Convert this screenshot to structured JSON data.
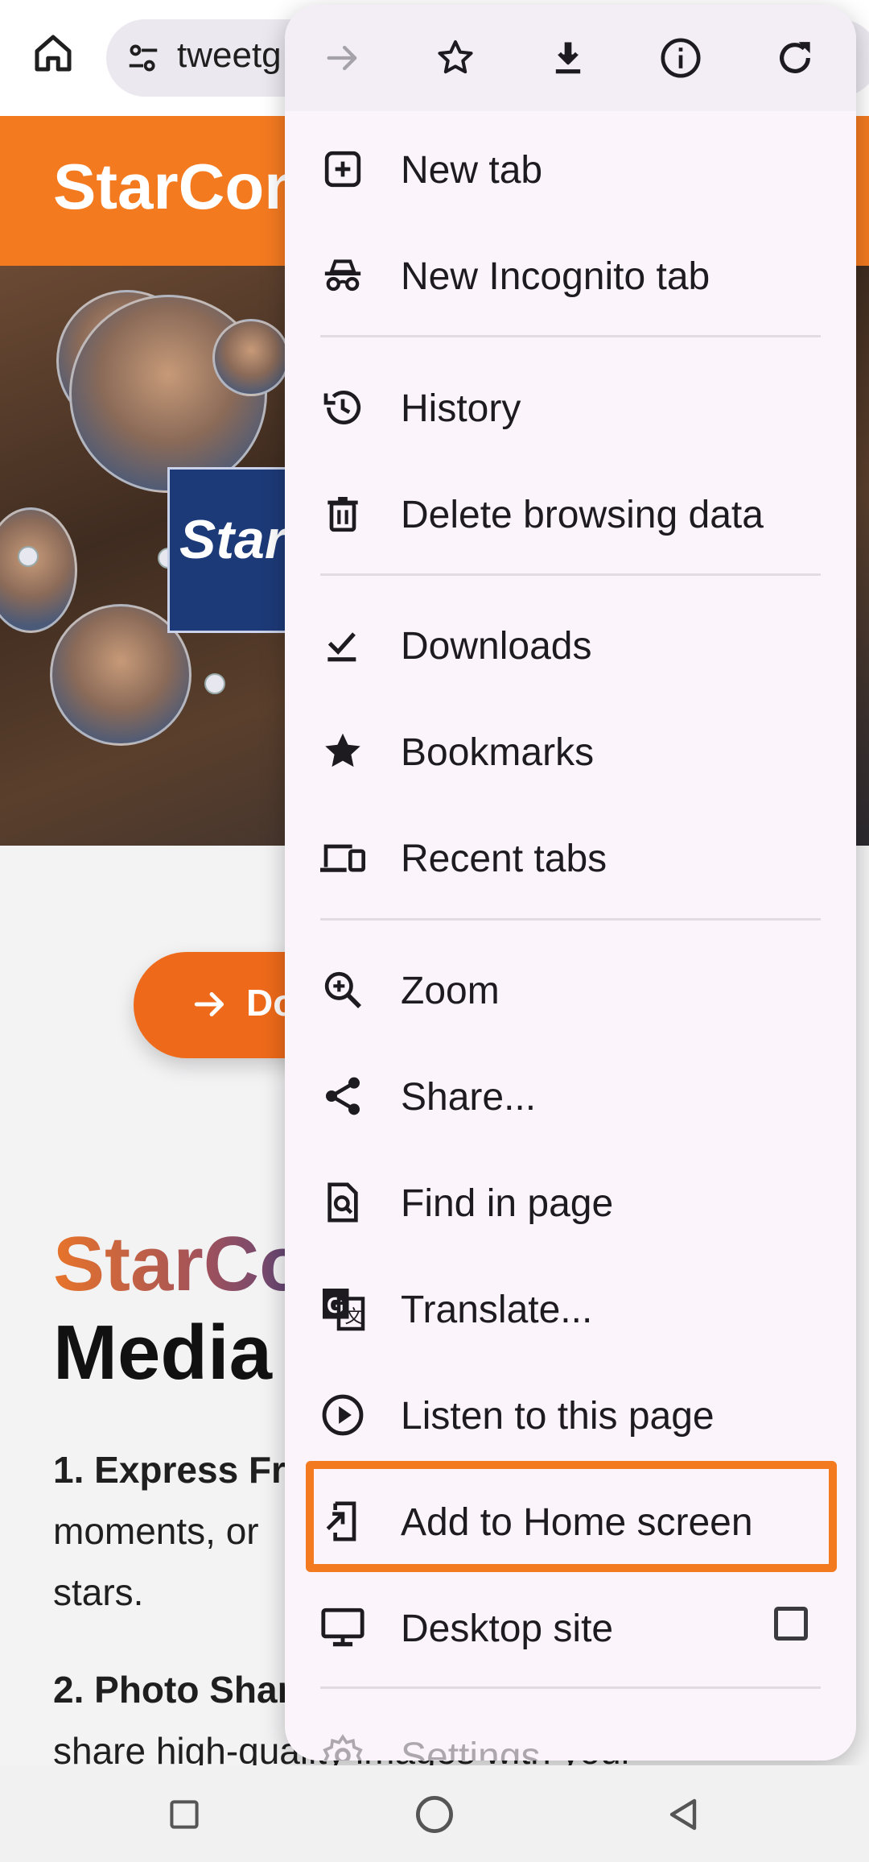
{
  "toolbar": {
    "url_text": "tweetg",
    "home_icon": "home-icon",
    "site_settings_icon": "tune-icon"
  },
  "page": {
    "brand_title": "StarCon",
    "hero_sign_text": "Star",
    "cta_label": "Do",
    "headline_line1": "StarCo",
    "headline_line2": "Media A",
    "section1_title": "1. Express Fr",
    "section1_line1": "moments, or",
    "section1_line2": "stars.",
    "section2_title": "2. Photo Shar",
    "section2_line1": "share high-quality images with your"
  },
  "menu": {
    "top_actions": [
      {
        "name": "forward-icon"
      },
      {
        "name": "star-outline-icon"
      },
      {
        "name": "download-icon"
      },
      {
        "name": "info-icon"
      },
      {
        "name": "refresh-icon"
      }
    ],
    "items": [
      {
        "label": "New tab",
        "icon": "new-tab-icon"
      },
      {
        "label": "New Incognito tab",
        "icon": "incognito-icon"
      },
      {
        "label": "History",
        "icon": "history-icon"
      },
      {
        "label": "Delete browsing data",
        "icon": "trash-icon"
      },
      {
        "label": "Downloads",
        "icon": "downloads-check-icon"
      },
      {
        "label": "Bookmarks",
        "icon": "star-filled-icon"
      },
      {
        "label": "Recent tabs",
        "icon": "devices-icon"
      },
      {
        "label": "Zoom",
        "icon": "zoom-in-icon"
      },
      {
        "label": "Share...",
        "icon": "share-icon"
      },
      {
        "label": "Find in page",
        "icon": "find-in-page-icon"
      },
      {
        "label": "Translate...",
        "icon": "translate-icon"
      },
      {
        "label": "Listen to this page",
        "icon": "play-circle-icon"
      },
      {
        "label": "Add to Home screen",
        "icon": "add-to-home-icon",
        "highlighted": true
      },
      {
        "label": "Desktop site",
        "icon": "monitor-icon",
        "checked": false
      },
      {
        "label": "Settings",
        "icon": "gear-icon"
      }
    ],
    "highlight_color": "#f47a20"
  },
  "navbar": {
    "recents_icon": "square-icon",
    "home_icon": "circle-icon",
    "back_icon": "triangle-back-icon"
  },
  "colors": {
    "accent_orange": "#f47a20",
    "menu_bg": "#fbf4fa"
  }
}
